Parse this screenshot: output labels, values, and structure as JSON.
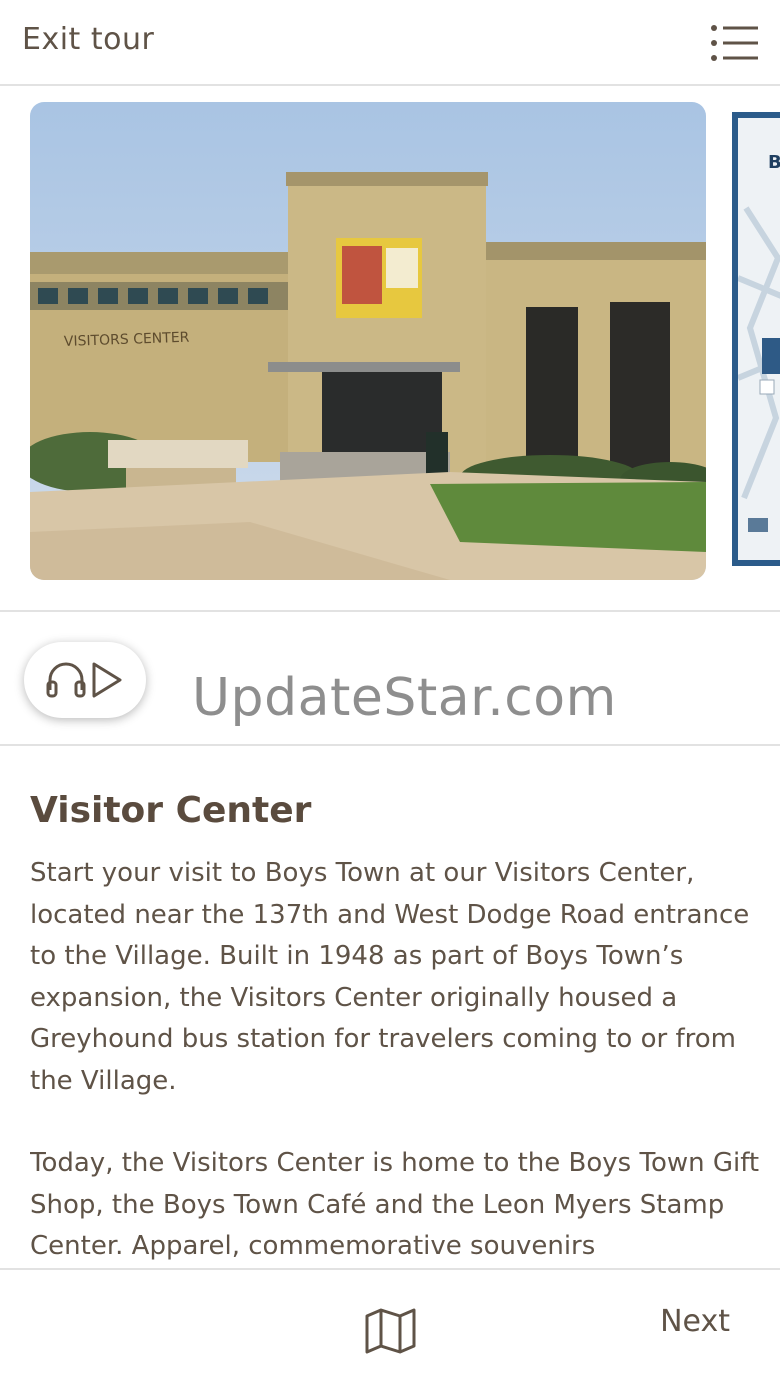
{
  "header": {
    "exit_label": "Exit tour",
    "menu_icon": "list-menu-icon"
  },
  "gallery": {
    "photo_icon": "visitors-center-photo",
    "next_photo_icon": "map-thumbnail"
  },
  "audio": {
    "icon": "headphones-play-icon",
    "watermark": "UpdateStar.com"
  },
  "stop": {
    "title": "Visitor Center",
    "paragraphs": [
      "Start your visit to Boys Town at our Visitors Center, located near the 137th and West Dodge Road entrance to the Village. Built in 1948 as part of Boys Town’s expansion, the Visitors Center originally housed a Greyhound bus station for travelers coming to or from the Village.",
      "Today, the Visitors Center is home to the Boys Town Gift Shop, the Boys Town Café and the Leon Myers Stamp Center. Apparel, commemorative souvenirs"
    ]
  },
  "footer": {
    "map_icon": "map-icon",
    "next_label": "Next"
  },
  "colors": {
    "text": "#5f5347",
    "divider": "#e2e2e2",
    "thumbnail_border": "#2b5b8a"
  }
}
